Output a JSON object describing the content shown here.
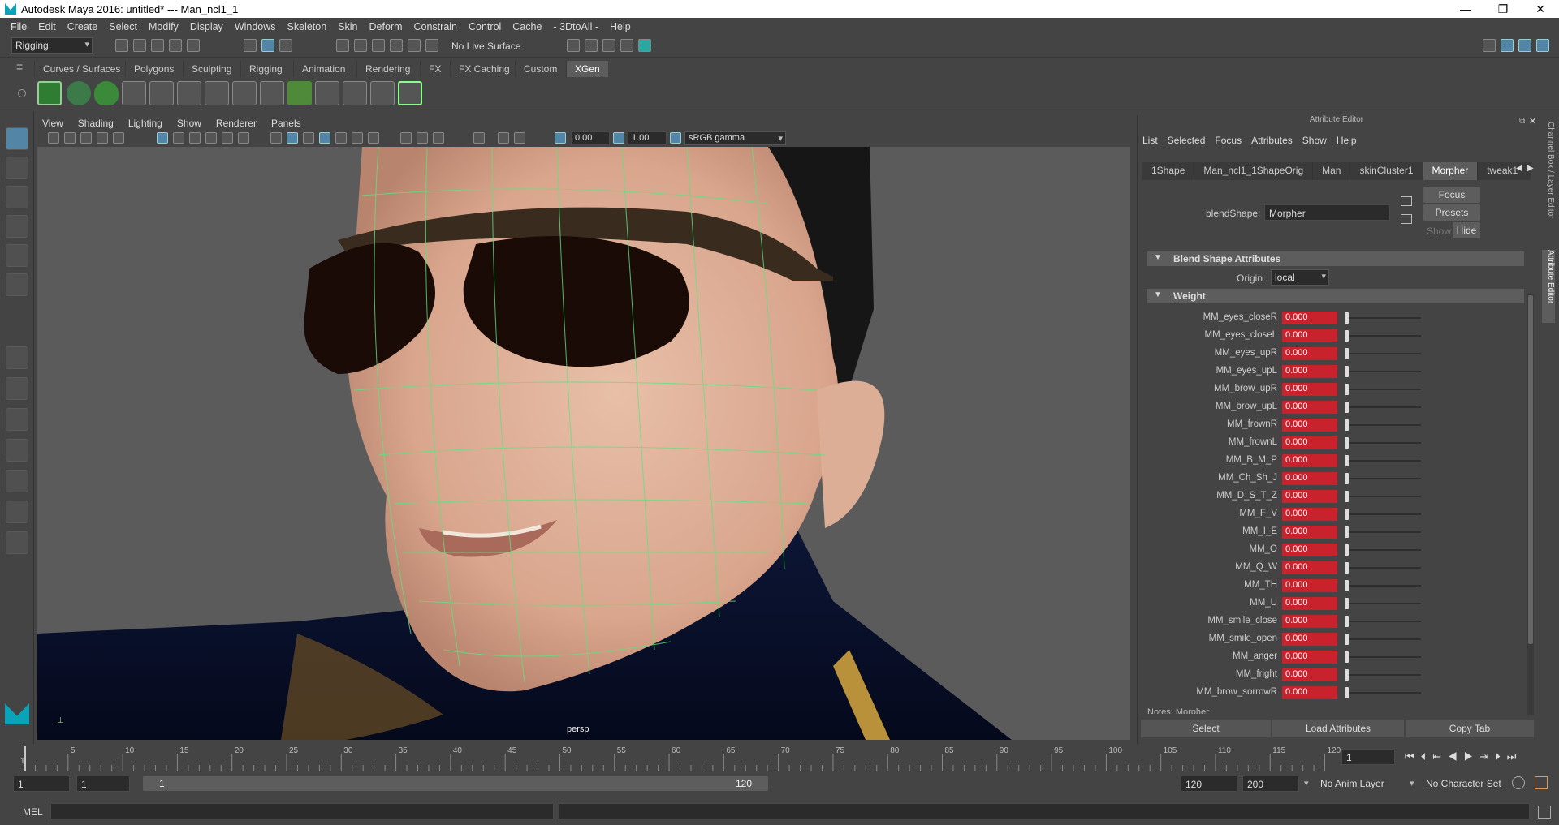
{
  "window": {
    "title": "Autodesk Maya 2016: untitled*   ---   Man_ncl1_1"
  },
  "menubar": [
    "File",
    "Edit",
    "Create",
    "Select",
    "Modify",
    "Display",
    "Windows",
    "Skeleton",
    "Skin",
    "Deform",
    "Constrain",
    "Control",
    "Cache",
    "- 3DtoAll -",
    "Help"
  ],
  "statusline": {
    "menuset": "Rigging",
    "live_surface": "No Live Surface"
  },
  "shelf_tabs": [
    "Curves / Surfaces",
    "Polygons",
    "Sculpting",
    "Rigging",
    "Animation",
    "Rendering",
    "FX",
    "FX Caching",
    "Custom",
    "XGen"
  ],
  "shelf_active": "XGen",
  "viewport": {
    "menu": [
      "View",
      "Shading",
      "Lighting",
      "Show",
      "Renderer",
      "Panels"
    ],
    "exposure": "0.00",
    "gamma": "1.00",
    "colorspace": "sRGB gamma",
    "camera_label": "persp"
  },
  "attribute_editor": {
    "header": "Attribute Editor",
    "menu": [
      "List",
      "Selected",
      "Focus",
      "Attributes",
      "Show",
      "Help"
    ],
    "tabs": [
      "1Shape",
      "Man_ncl1_1ShapeOrig",
      "Man",
      "skinCluster1",
      "Morpher",
      "tweak1"
    ],
    "active_tab": "Morpher",
    "blendshape_label": "blendShape:",
    "blendshape_value": "Morpher",
    "focus_btn": "Focus",
    "presets_btn": "Presets",
    "show_btn": "Show",
    "hide_btn": "Hide",
    "section_blend": "Blend Shape Attributes",
    "origin_label": "Origin",
    "origin_value": "local",
    "section_weight": "Weight",
    "weights": [
      {
        "name": "MM_eyes_closeR",
        "value": "0.000"
      },
      {
        "name": "MM_eyes_closeL",
        "value": "0.000"
      },
      {
        "name": "MM_eyes_upR",
        "value": "0.000"
      },
      {
        "name": "MM_eyes_upL",
        "value": "0.000"
      },
      {
        "name": "MM_brow_upR",
        "value": "0.000"
      },
      {
        "name": "MM_brow_upL",
        "value": "0.000"
      },
      {
        "name": "MM_frownR",
        "value": "0.000"
      },
      {
        "name": "MM_frownL",
        "value": "0.000"
      },
      {
        "name": "MM_B_M_P",
        "value": "0.000"
      },
      {
        "name": "MM_Ch_Sh_J",
        "value": "0.000"
      },
      {
        "name": "MM_D_S_T_Z",
        "value": "0.000"
      },
      {
        "name": "MM_F_V",
        "value": "0.000"
      },
      {
        "name": "MM_I_E",
        "value": "0.000"
      },
      {
        "name": "MM_O",
        "value": "0.000"
      },
      {
        "name": "MM_Q_W",
        "value": "0.000"
      },
      {
        "name": "MM_TH",
        "value": "0.000"
      },
      {
        "name": "MM_U",
        "value": "0.000"
      },
      {
        "name": "MM_smile_close",
        "value": "0.000"
      },
      {
        "name": "MM_smile_open",
        "value": "0.000"
      },
      {
        "name": "MM_anger",
        "value": "0.000"
      },
      {
        "name": "MM_fright",
        "value": "0.000"
      },
      {
        "name": "MM_brow_sorrowR",
        "value": "0.000"
      }
    ],
    "notes_label": "Notes: Morpher",
    "bottom_buttons": [
      "Select",
      "Load Attributes",
      "Copy Tab"
    ]
  },
  "side_tabs": [
    "Channel Box / Layer Editor",
    "Attribute Editor"
  ],
  "timeline": {
    "ticks": [
      "5",
      "10",
      "15",
      "20",
      "25",
      "30",
      "35",
      "40",
      "45",
      "50",
      "55",
      "60",
      "65",
      "70",
      "75",
      "80",
      "85",
      "90",
      "95",
      "100",
      "105",
      "110",
      "115",
      "120"
    ],
    "start_label": "1",
    "current_frame": "1"
  },
  "range": {
    "start": "1",
    "playback_start": "1",
    "slider_start": "1",
    "slider_end": "120",
    "playback_end": "120",
    "end": "200",
    "anim_layer": "No Anim Layer",
    "character_set": "No Character Set"
  },
  "cmdline": {
    "label": "MEL"
  }
}
